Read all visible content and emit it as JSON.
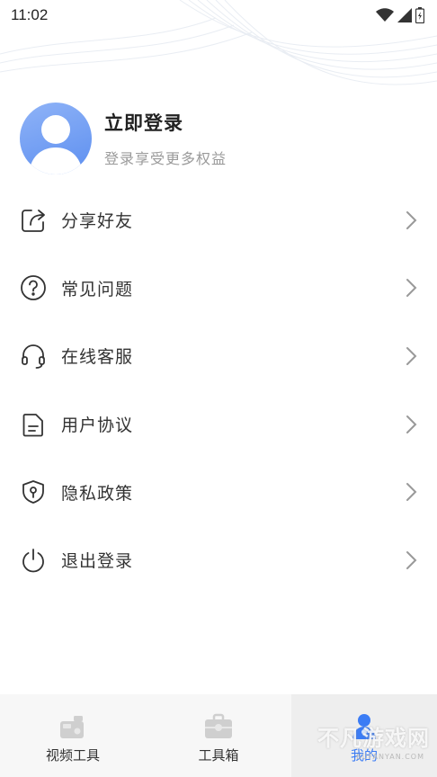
{
  "status_bar": {
    "time": "11:02"
  },
  "profile": {
    "title": "立即登录",
    "subtitle": "登录享受更多权益"
  },
  "menu": {
    "items": [
      {
        "label": "分享好友",
        "icon": "share-icon"
      },
      {
        "label": "常见问题",
        "icon": "question-icon"
      },
      {
        "label": "在线客服",
        "icon": "headset-icon"
      },
      {
        "label": "用户协议",
        "icon": "document-icon"
      },
      {
        "label": "隐私政策",
        "icon": "shield-icon"
      },
      {
        "label": "退出登录",
        "icon": "power-icon"
      }
    ]
  },
  "tabbar": {
    "tabs": [
      {
        "label": "视频工具",
        "icon": "video-tools-icon",
        "active": false
      },
      {
        "label": "工具箱",
        "icon": "toolbox-icon",
        "active": false
      },
      {
        "label": "我的",
        "icon": "profile-icon",
        "active": true
      }
    ]
  },
  "watermark": {
    "text": "不凡游戏网",
    "sub": "BUFANYAN.COM"
  },
  "colors": {
    "accent": "#3b7cf5",
    "avatar": "#5d8ff0",
    "text": "#333333",
    "muted": "#9a9a9a"
  }
}
